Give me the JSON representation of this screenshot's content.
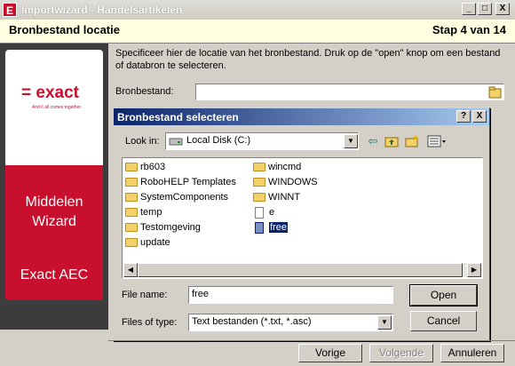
{
  "window": {
    "title": "Importwizard - Handelsartikelen",
    "minimize": "_",
    "maximize": "□",
    "close": "X",
    "app_icon": "E"
  },
  "header": {
    "title": "Bronbestand locatie",
    "step": "Stap 4 van 14"
  },
  "banner": {
    "logo": "= exact",
    "tagline": "And it all comes together.",
    "line1": "Middelen",
    "line2": "Wizard",
    "product": "Exact AEC"
  },
  "content": {
    "description": "Specificeer hier de locatie van het bronbestand. Druk op de \"open\" knop om een bestand of databron te selecteren.",
    "source_label": "Bronbestand:",
    "source_value": ""
  },
  "dialog": {
    "title": "Bronbestand selecteren",
    "help_button": "?",
    "close_button": "X",
    "look_in_label": "Look in:",
    "look_in_value": "Local Disk (C:)",
    "files_col1": [
      "rb603",
      "RoboHELP Templates",
      "SystemComponents",
      "temp",
      "Testomgeving",
      "update"
    ],
    "files_col2": [
      "wincmd",
      "WINDOWS",
      "WINNT",
      "e",
      "free"
    ],
    "selected_file": "free",
    "file_name_label": "File name:",
    "file_name_value": "free",
    "file_type_label": "Files of type:",
    "file_type_value": "Text bestanden (*.txt, *.asc)",
    "open_button": "Open",
    "cancel_button": "Cancel"
  },
  "footer": {
    "prev_button": "Vorige",
    "next_button": "Volgende",
    "cancel_button": "Annuleren"
  },
  "colors": {
    "brand": "#c8102e",
    "selection": "#0a246a",
    "header_bg": "#ffffe1"
  }
}
